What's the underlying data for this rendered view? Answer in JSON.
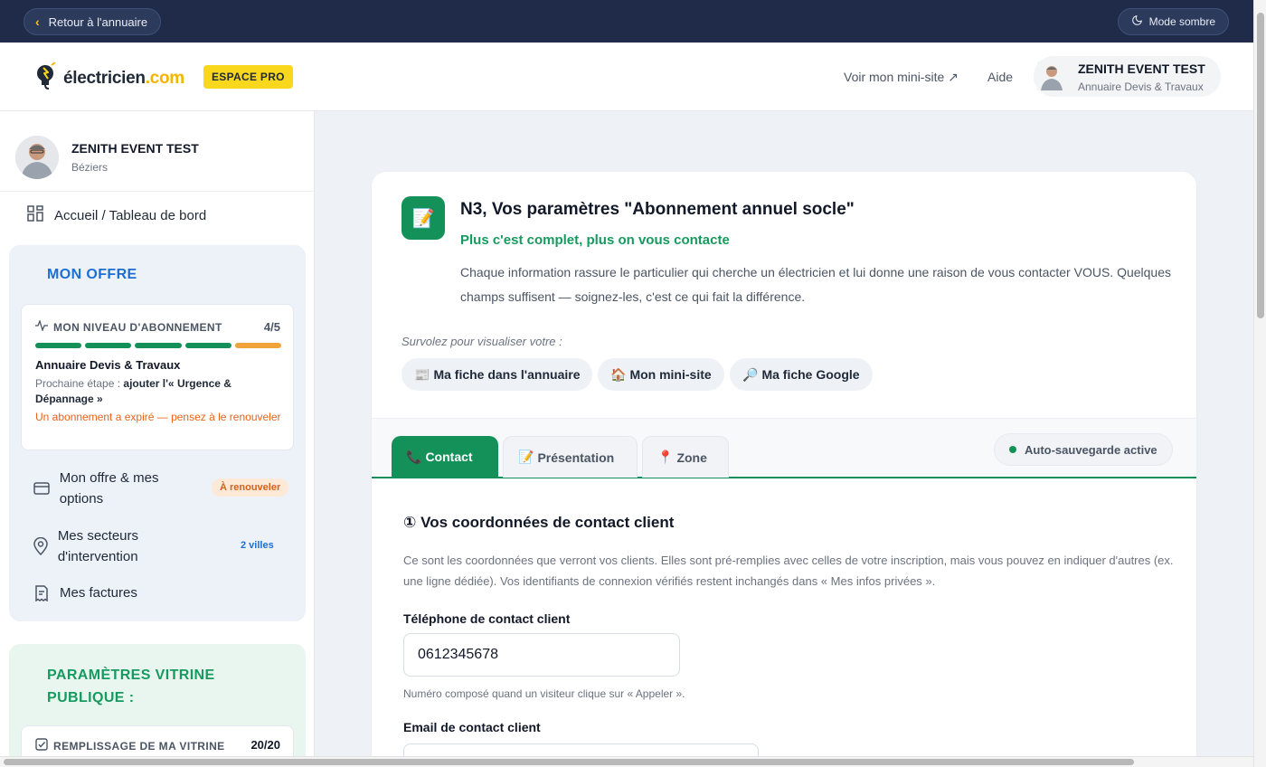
{
  "topbar": {
    "back_label": "Retour à l'annuaire",
    "dark_mode_label": "Mode sombre"
  },
  "header": {
    "logo_main": "électricien",
    "logo_tld": ".com",
    "pro_badge": "ESPACE PRO",
    "mini_site_link": "Voir mon mini-site ↗",
    "help_link": "Aide",
    "user_name": "ZENITH EVENT TEST",
    "user_plan": "Annuaire Devis & Travaux"
  },
  "sidebar": {
    "profile_name": "ZENITH EVENT TEST",
    "profile_city": "Béziers",
    "home_label": "Accueil / Tableau de bord",
    "offer": {
      "title": "MON OFFRE",
      "level_label": "MON NIVEAU D'ABONNEMENT",
      "level_count": "4/5",
      "level_value": 4,
      "level_max": 5,
      "plan_name": "Annuaire Devis & Travaux",
      "next_step_prefix": "Prochaine étape : ",
      "next_step_value": "ajouter l'« Urgence & Dépannage »",
      "warning": "Un abonnement a expiré — pensez à le renouveler"
    },
    "items": [
      {
        "label": "Mon offre & mes options",
        "badge": "À renouveler",
        "icon": "credit-card-icon"
      },
      {
        "label": "Mes secteurs d'intervention",
        "badge": "2 villes",
        "icon": "map-pin-icon"
      },
      {
        "label": "Mes factures",
        "icon": "invoice-icon"
      }
    ],
    "vitrine": {
      "title": "PARAMÈTRES VITRINE PUBLIQUE :",
      "fill_label": "REMPLISSAGE DE MA VITRINE",
      "fill_count": "20/20"
    }
  },
  "main": {
    "icon_glyph": "📝",
    "title": "N3, Vos paramètres \"Abonnement annuel socle\"",
    "subtitle": "Plus c'est complet, plus on vous contacte",
    "description": "Chaque information rassure le particulier qui cherche un électricien et lui donne une raison de vous contacter VOUS. Quelques champs suffisent — soignez-les, c'est ce qui fait la différence.",
    "hover_hint": "Survolez pour visualiser votre :",
    "preview_buttons": [
      {
        "glyph": "📰",
        "label": "Ma fiche dans l'annuaire"
      },
      {
        "glyph": "🏠",
        "label": "Mon mini-site"
      },
      {
        "glyph": "🔎",
        "label": "Ma fiche Google"
      }
    ],
    "tabs": [
      {
        "glyph": "📞",
        "label": "Contact"
      },
      {
        "glyph": "📝",
        "label": "Présentation"
      },
      {
        "glyph": "📍",
        "label": "Zone"
      }
    ],
    "autosave": "Auto-sauvegarde active",
    "section_title": "① Vos coordonnées de contact client",
    "section_desc": "Ce sont les coordonnées que verront vos clients. Elles sont pré-remplies avec celles de votre inscription, mais vous pouvez en indiquer d'autres (ex. une ligne dédiée). Vos identifiants de connexion vérifiés restent inchangés dans « Mes infos privées ».",
    "phone_label": "Téléphone de contact client",
    "phone_value": "0612345678",
    "phone_help": "Numéro composé quand un visiteur clique sur « Appeler ».",
    "email_label": "Email de contact client",
    "email_value": ""
  },
  "colors": {
    "brand_navy": "#1f2b48",
    "brand_green": "#149158",
    "brand_yellow": "#f9d71c",
    "offer_blue": "#1d6fd6",
    "warning_orange": "#e8641b"
  }
}
